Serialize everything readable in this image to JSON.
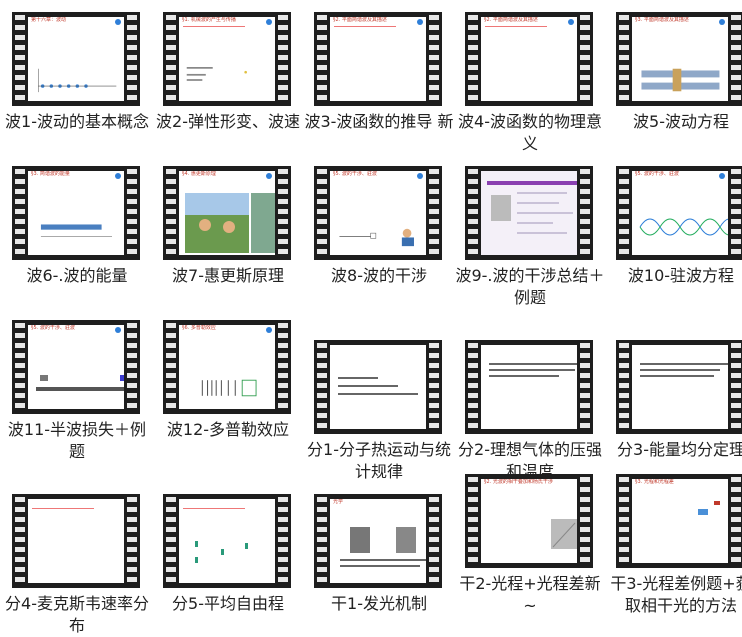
{
  "tiles": [
    {
      "caption": "波1-波动的基本概念",
      "header": "第十六章：波动"
    },
    {
      "caption": "波2-弹性形变、波速",
      "header": "§1. 机械波的产生与传播"
    },
    {
      "caption": "波3-波函数的推导 新",
      "header": "§2. 平面简谐波及其描述"
    },
    {
      "caption": "波4-波函数的物理意义",
      "header": "§2. 平面简谐波及其描述"
    },
    {
      "caption": "波5-波动方程",
      "header": "§3. 平面简谐波及其描述"
    },
    {
      "caption": "波6-.波的能量",
      "header": "§3. 简谐波的能量"
    },
    {
      "caption": "波7-惠更斯原理",
      "header": "§4. 惠更斯原理"
    },
    {
      "caption": "波8-波的干涉",
      "header": "§5. 波的干涉、驻波"
    },
    {
      "caption": "波9-.波的干涉总结＋例题",
      "header": ""
    },
    {
      "caption": "波10-驻波方程",
      "header": "§5. 波的干涉、驻波"
    },
    {
      "caption": "波11-半波损失＋例题",
      "header": "§5. 波的干涉、驻波"
    },
    {
      "caption": "波12-多普勒效应",
      "header": "§6. 多普勒效应"
    },
    {
      "caption": "分1-分子热运动与统计规律",
      "header": ""
    },
    {
      "caption": "分2-理想气体的压强和温度",
      "header": ""
    },
    {
      "caption": "分3-能量均分定理",
      "header": ""
    },
    {
      "caption": "分4-麦克斯韦速率分布",
      "header": ""
    },
    {
      "caption": "分5-平均自由程",
      "header": ""
    },
    {
      "caption": "干1-发光机制",
      "header": "光学"
    },
    {
      "caption": "干2-光程+光程差新~",
      "header": "§2. 光波的相干叠加和杨氏干涉"
    },
    {
      "caption": "干3-光程差例题+获取相干光的方法",
      "header": "§3. 光程和光程差"
    }
  ],
  "accent": "#2f7fd8",
  "film_color": "#1e1e1e"
}
